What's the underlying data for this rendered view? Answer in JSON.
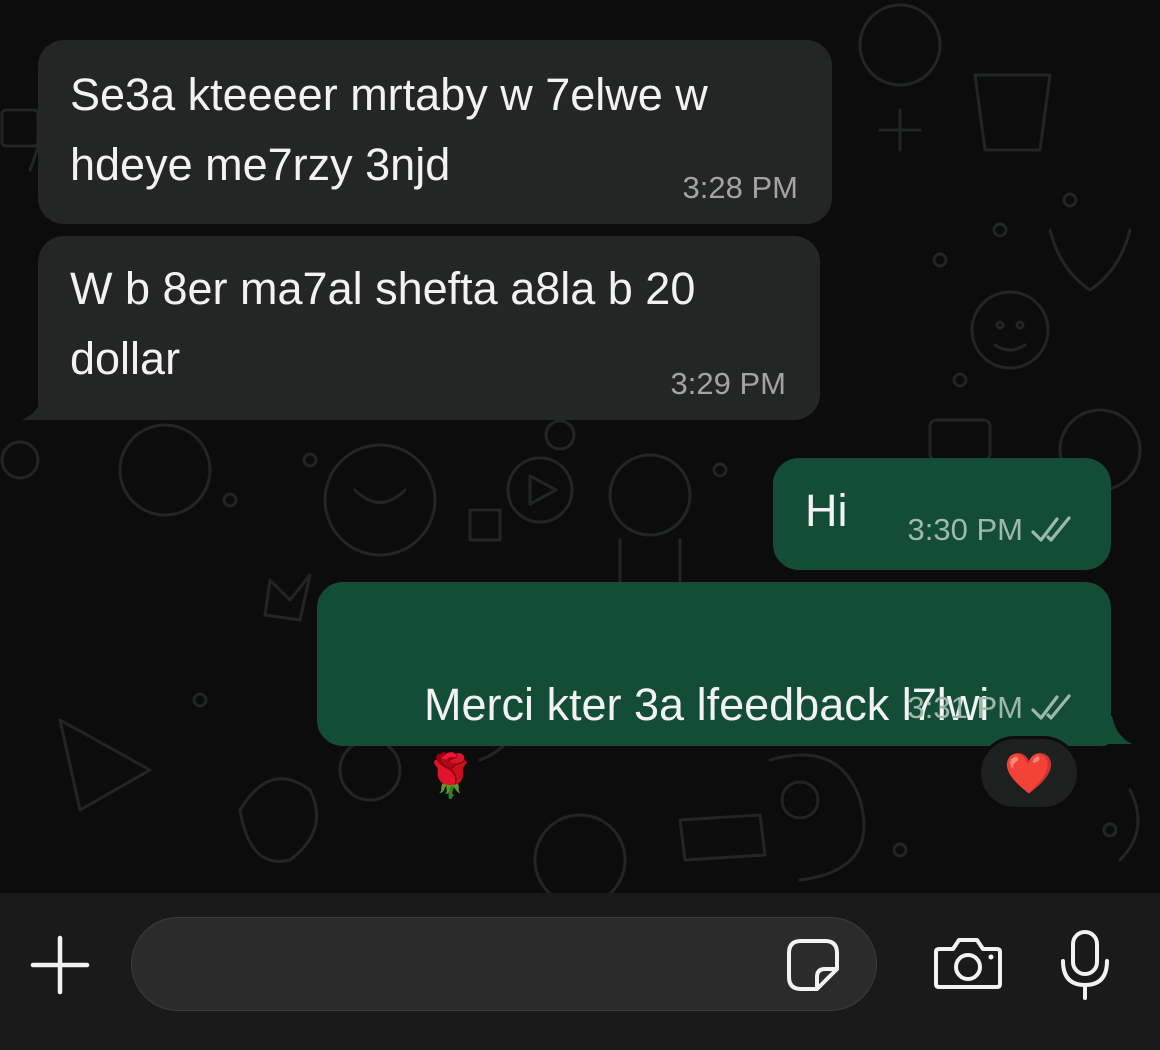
{
  "messages": [
    {
      "direction": "incoming",
      "text": "Se3a kteeeer mrtaby w 7elwe w\nhdeye me7rzy 3njd",
      "time": "3:28 PM"
    },
    {
      "direction": "incoming",
      "text": "W b 8er ma7al shefta a8la b 20\ndollar",
      "time": "3:29 PM"
    },
    {
      "direction": "outgoing",
      "text": "Hi",
      "time": "3:30 PM",
      "status_icon": "double-check-icon"
    },
    {
      "direction": "outgoing",
      "text": "Merci kter 3a lfeedback l7lwi",
      "emoji": "🌹",
      "time": "3:31 PM",
      "status_icon": "double-check-icon"
    }
  ],
  "reaction": {
    "emoji": "❤️"
  },
  "composer": {
    "placeholder": "",
    "value": "",
    "icons": [
      "plus-icon",
      "sticker-icon",
      "camera-icon",
      "microphone-icon"
    ]
  },
  "colors": {
    "background": "#0c0c0c",
    "incoming_bubble": "#242626",
    "outgoing_bubble": "#134d37",
    "composer_bar": "#1a1a1a",
    "check_marks": "#9fb8ad"
  }
}
